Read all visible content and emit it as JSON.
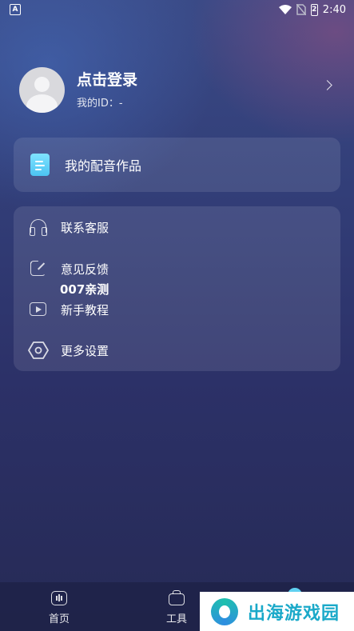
{
  "status_bar": {
    "notification_icon": "A",
    "battery_level": "2",
    "time": "2:40"
  },
  "profile": {
    "login_label": "点击登录",
    "id_label": "我的ID：-"
  },
  "works": {
    "label": "我的配音作品"
  },
  "menu": {
    "items": [
      {
        "label": "联系客服",
        "icon": "headset-icon"
      },
      {
        "label": "意见反馈",
        "icon": "edit-icon"
      },
      {
        "label": "新手教程",
        "icon": "play-icon"
      },
      {
        "label": "更多设置",
        "icon": "settings-icon"
      }
    ]
  },
  "overlay_text": "007亲测",
  "tabbar": {
    "tabs": [
      {
        "label": "首页",
        "icon": "voice-home-icon"
      },
      {
        "label": "工具",
        "icon": "toolbox-icon"
      }
    ]
  },
  "watermark": {
    "text": "出海游戏园"
  },
  "colors": {
    "accent": "#5fd0f0",
    "card_bg": "rgba(255,255,255,0.10)"
  }
}
